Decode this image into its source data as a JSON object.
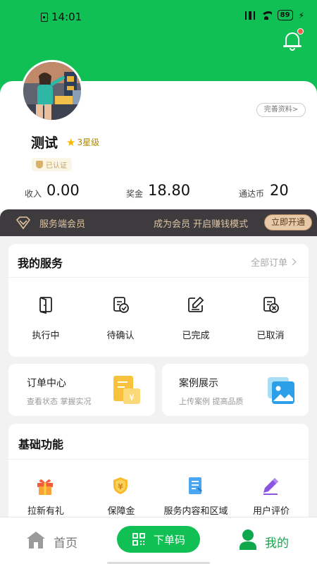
{
  "status_bar": {
    "time": "14:01",
    "battery": "89"
  },
  "profile": {
    "complete_label": "完善资料>",
    "name": "测试",
    "level": "3星级",
    "verified": "已认证"
  },
  "stats": [
    {
      "label": "收入",
      "value": "0.00"
    },
    {
      "label": "奖金",
      "value": "18.80"
    },
    {
      "label": "通达币",
      "value": "20"
    }
  ],
  "member": {
    "title": "服务端会员",
    "promo": "成为会员  开启赚钱模式",
    "button": "立即开通"
  },
  "my_services": {
    "title": "我的服务",
    "all_orders": "全部订单",
    "items": [
      {
        "label": "执行中",
        "icon": "door-icon"
      },
      {
        "label": "待确认",
        "icon": "clipboard-check-icon"
      },
      {
        "label": "已完成",
        "icon": "edit-icon"
      },
      {
        "label": "已取消",
        "icon": "clipboard-cancel-icon"
      }
    ]
  },
  "order_center": {
    "title": "订单中心",
    "subtitle": "查看状态  掌握实况"
  },
  "case_show": {
    "title": "案例展示",
    "subtitle": "上传案例  提高品质"
  },
  "basic_functions": {
    "title": "基础功能",
    "items": [
      {
        "label": "拉新有礼",
        "icon": "gift-icon"
      },
      {
        "label": "保障金",
        "icon": "shield-yen-icon"
      },
      {
        "label": "服务内容和区域",
        "icon": "document-icon"
      },
      {
        "label": "用户评价",
        "icon": "pencil-icon"
      }
    ]
  },
  "tabbar": {
    "home": "首页",
    "qr": "下单码",
    "me": "我的"
  },
  "colors": {
    "brand_green": "#10c055",
    "gold": "#dfc3a0",
    "dark_bar": "#3d3b3d"
  }
}
